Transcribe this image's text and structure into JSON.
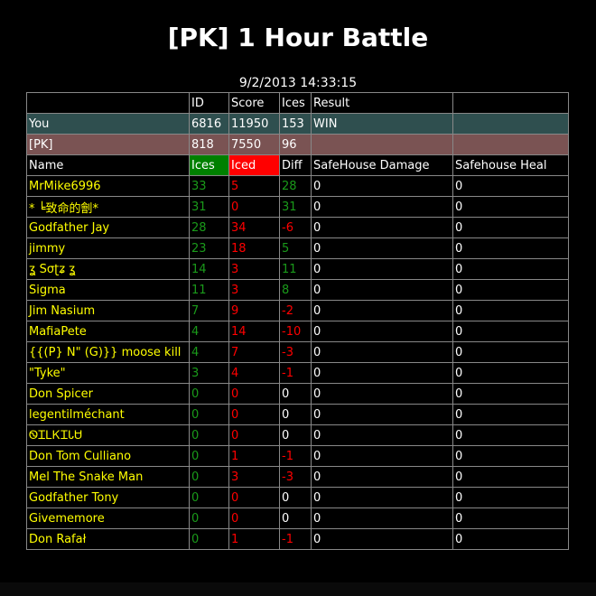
{
  "title": "[PK] 1 Hour Battle",
  "timestamp": "9/2/2013 14:33:15",
  "header_row": {
    "blank": "",
    "id": "ID",
    "score": "Score",
    "ices": "Ices",
    "result": "Result",
    "extra": ""
  },
  "you_row": {
    "label": "You",
    "id": "6816",
    "score": "11950",
    "ices": "153",
    "result": "WIN",
    "extra": ""
  },
  "pk_row": {
    "label": "[PK]",
    "id": "818",
    "score": "7550",
    "ices": "96",
    "result": "",
    "extra": ""
  },
  "column_headers": {
    "name": "Name",
    "ices": "Ices",
    "iced": "Iced",
    "diff": "Diff",
    "damage": "SafeHouse Damage",
    "heal": "Safehouse Heal"
  },
  "colors": {
    "you_row_bg": "#2f4f4f",
    "pk_row_bg": "#7a5353",
    "ices_header": "#008000",
    "iced_header": "#ff0000",
    "name_text": "#ffff00"
  },
  "players": [
    {
      "name": "MrMike6996",
      "ices": "33",
      "iced": "5",
      "diff": "28",
      "damage": "0",
      "heal": "0"
    },
    {
      "name": "* ╘致命的劊*",
      "ices": "31",
      "iced": "0",
      "diff": "31",
      "damage": "0",
      "heal": "0"
    },
    {
      "name": "Godfather Jay",
      "ices": "28",
      "iced": "34",
      "diff": "-6",
      "damage": "0",
      "heal": "0"
    },
    {
      "name": "jimmy",
      "ices": "23",
      "iced": "18",
      "diff": "5",
      "damage": "0",
      "heal": "0"
    },
    {
      "name": "ʓ Ѕσʈʑ ʓ",
      "ices": "14",
      "iced": "3",
      "diff": "11",
      "damage": "0",
      "heal": "0"
    },
    {
      "name": "Sigma",
      "ices": "11",
      "iced": "3",
      "diff": "8",
      "damage": "0",
      "heal": "0"
    },
    {
      "name": "Jim Nasium",
      "ices": "7",
      "iced": "9",
      "diff": "-2",
      "damage": "0",
      "heal": "0"
    },
    {
      "name": "MafiaPete",
      "ices": "4",
      "iced": "14",
      "diff": "-10",
      "damage": "0",
      "heal": "0"
    },
    {
      "name": "{{(P} N\" (G)}} moose kill",
      "ices": "4",
      "iced": "7",
      "diff": "-3",
      "damage": "0",
      "heal": "0"
    },
    {
      "name": "\"Tyke\"",
      "ices": "3",
      "iced": "4",
      "diff": "-1",
      "damage": "0",
      "heal": "0"
    },
    {
      "name": "Don Spicer",
      "ices": "0",
      "iced": "0",
      "diff": "0",
      "damage": "0",
      "heal": "0"
    },
    {
      "name": "legentilméchant",
      "ices": "0",
      "iced": "0",
      "diff": "0",
      "damage": "0",
      "heal": "0"
    },
    {
      "name": "ᏫᏆᏞᏦᏆᏓᏌ",
      "ices": "0",
      "iced": "0",
      "diff": "0",
      "damage": "0",
      "heal": "0"
    },
    {
      "name": "Don Tom Culliano",
      "ices": "0",
      "iced": "1",
      "diff": "-1",
      "damage": "0",
      "heal": "0"
    },
    {
      "name": "Mel The Snake Man",
      "ices": "0",
      "iced": "3",
      "diff": "-3",
      "damage": "0",
      "heal": "0"
    },
    {
      "name": "Godfather Tony",
      "ices": "0",
      "iced": "0",
      "diff": "0",
      "damage": "0",
      "heal": "0"
    },
    {
      "name": "Givememore",
      "ices": "0",
      "iced": "0",
      "diff": "0",
      "damage": "0",
      "heal": "0"
    },
    {
      "name": "Don Rafał",
      "ices": "0",
      "iced": "1",
      "diff": "-1",
      "damage": "0",
      "heal": "0"
    }
  ]
}
